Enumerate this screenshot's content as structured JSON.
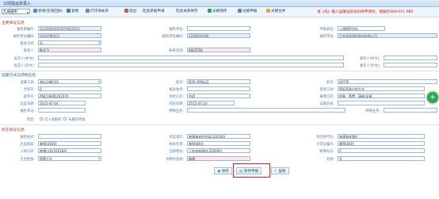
{
  "window": {
    "title": "订阅指运单录入"
  },
  "toolbar": {
    "type_select": "九城通单",
    "buttons": [
      {
        "label": "新增(在线回执)"
      },
      {
        "label": "复制"
      },
      {
        "label": "打印海关单"
      },
      {
        "label": "退出"
      },
      {
        "label": "检查单据申请"
      },
      {
        "label": "检查关单保存"
      },
      {
        "label": "光模保存"
      },
      {
        "label": "光模申报"
      },
      {
        "label": "光模合并"
      }
    ],
    "notice": "请《先》输入运输号段号码并申请时，请拨打400-011-985"
  },
  "sections": {
    "basic": "主要单证信息",
    "transport": "运输方式与场地信息",
    "other": "所在单证信息"
  },
  "basic": {
    "labels": {
      "manifest_no": "报检单编号:",
      "enterprise": "报检单位:",
      "enterprise_code": "报检单位编码:",
      "mode": "报关方式:",
      "contact": "联系人:",
      "phone": "联系电话:",
      "status": "申报状态:",
      "inspect_date": "报检单位:",
      "consignor_cn": "发货人(中文):",
      "consignor_en": "发货人(外文):",
      "consignee_cn": "收货人(中文):",
      "consignee_en": "收货人(外文):"
    },
    "values": {
      "manifest_no": "12320092015070023012",
      "enterprise": "3200780427",
      "enterprise_code": "3200818198",
      "mode": "无",
      "contact": "陈文飞",
      "phone": "6007250",
      "status": "入境报检包括",
      "inspect_date": "江苏润泽国际物流有限公司"
    }
  },
  "transport": {
    "labels": {
      "transport": "运输工具:",
      "vessel": "船名:",
      "voyage": "航次:",
      "order": "合同号:",
      "bill": "提单号:",
      "place": "报关地点:",
      "arrive": "到达口岸:",
      "trade": "贸易方式:",
      "ship_date": "启运日期:",
      "arrive_date": "到货日期:",
      "depart": "离境口岸:",
      "decl": "报检单证:",
      "transport_mode": "运输方式:",
      "special": "特殊业务:",
      "check": "检验:"
    },
    "values": {
      "transport": "海运运输(20)",
      "vessel": "MYE APOLLO",
      "voyage": "0077E",
      "order": "0",
      "bill": "ANL5480D202070",
      "place": "中途",
      "ship_date": "2015-07-04",
      "arrive_date": "2015-07-24",
      "trade": "国际贸易过程方式",
      "depart": "拼装、等费、请单/运单",
      "transport_mode": "",
      "decl": ""
    },
    "checks": [
      "已入境报检",
      "未报检单据"
    ]
  },
  "other": {
    "labels": {
      "port_in": "报检地点:",
      "origin": "启运国家:",
      "entry": "入境口岸:",
      "enterprise_type": "企业性质:",
      "ship_port": "转运港口:",
      "org": "机构负责:",
      "reg": "注册地址:",
      "goods_place": "货物存放地:",
      "dest": "目的地代码:",
      "approval": "许可证编号:",
      "mark": "特殊标记:",
      "extra": "其他:"
    },
    "values": {
      "port_in": "南通",
      "origin": "美国(US00)",
      "entry": "南通口岸(320183)",
      "enterprise_type": "国营企业",
      "ship_port": "南通海关检验局(320100)",
      "org": "美国(840)",
      "reg": "江苏省南通市(320600)",
      "goods_place": "南通",
      "dest": "南通海关辖区",
      "approval": "美国(840)",
      "mark": "0",
      "extra": "无"
    }
  },
  "footer": {
    "save": "保存",
    "declare": "保存申报",
    "copy": "复制"
  },
  "colors": {
    "accent": "#1f5fa8",
    "highlight": "#e02020",
    "fab": "#2fa84f"
  }
}
